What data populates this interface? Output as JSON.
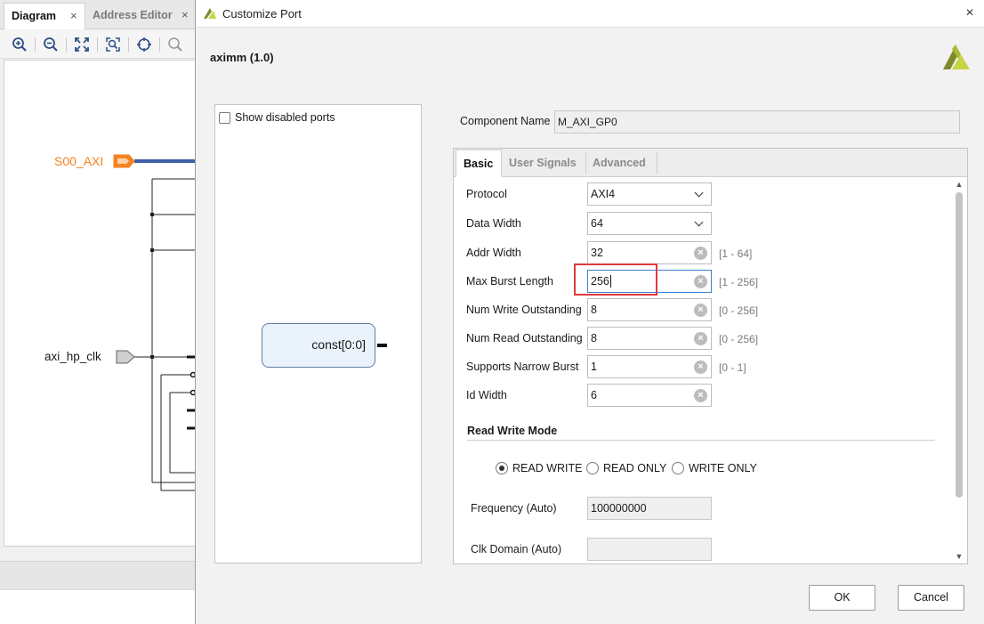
{
  "background": {
    "tabs": [
      {
        "label": "Diagram",
        "close": "×"
      },
      {
        "label": "Address Editor",
        "close": "×"
      }
    ],
    "toolbar_icons": [
      "zoom-in-icon",
      "zoom-out-icon",
      "fit-view-icon",
      "fit-selection-icon",
      "target-icon",
      "search-icon"
    ],
    "ports": {
      "s00_axi": "S00_AXI",
      "axi_hp_clk": "axi_hp_clk"
    },
    "colors": {
      "axi_port": "#f58220",
      "bus_line": "#3d5fa8"
    }
  },
  "dialog": {
    "title": "Customize Port",
    "close_glyph": "×",
    "ip_name": "aximm (1.0)",
    "show_disabled_ports": {
      "label": "Show disabled ports",
      "checked": false
    },
    "block": {
      "label": "const[0:0]"
    },
    "component_name": {
      "label": "Component Name",
      "value": "M_AXI_GP0"
    },
    "tabs": [
      {
        "label": "Basic",
        "active": true
      },
      {
        "label": "User Signals",
        "active": false
      },
      {
        "label": "Advanced",
        "active": false
      }
    ],
    "params": {
      "protocol": {
        "label": "Protocol",
        "value": "AXI4"
      },
      "data_width": {
        "label": "Data Width",
        "value": "64"
      },
      "addr_width": {
        "label": "Addr Width",
        "value": "32",
        "range": "[1 - 64]"
      },
      "max_burst": {
        "label": "Max Burst Length",
        "value": "256",
        "range": "[1 - 256]"
      },
      "num_write": {
        "label": "Num Write Outstanding",
        "value": "8",
        "range": "[0 - 256]"
      },
      "num_read": {
        "label": "Num Read Outstanding",
        "value": "8",
        "range": "[0 - 256]"
      },
      "narrow_burst": {
        "label": "Supports Narrow Burst",
        "value": "1",
        "range": "[0 - 1]"
      },
      "id_width": {
        "label": "Id Width",
        "value": "6"
      }
    },
    "rw_mode": {
      "title": "Read Write Mode",
      "options": [
        {
          "label": "READ WRITE",
          "selected": true
        },
        {
          "label": "READ ONLY",
          "selected": false
        },
        {
          "label": "WRITE ONLY",
          "selected": false
        }
      ]
    },
    "frequency": {
      "label": "Frequency (Auto)",
      "value": "100000000"
    },
    "clk_domain": {
      "label": "Clk Domain (Auto)",
      "value": ""
    },
    "buttons": {
      "ok": "OK",
      "cancel": "Cancel"
    },
    "highlight_color": "#e03a3a"
  }
}
